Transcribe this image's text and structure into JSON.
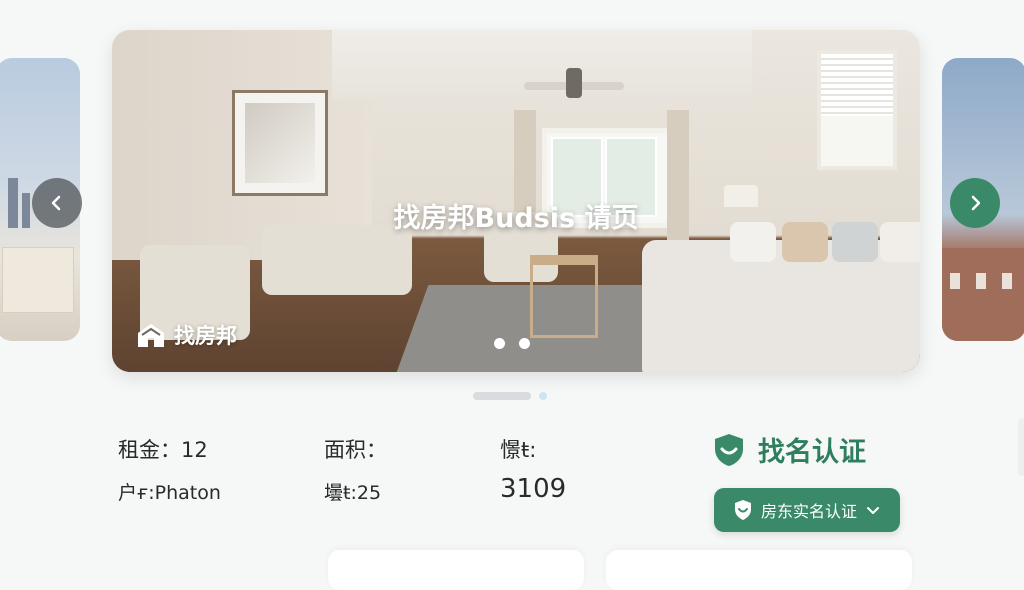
{
  "hero": {
    "title": "找房邦Budsis 请页",
    "brand_name": "找房邦",
    "indicator_dots": 2
  },
  "info": {
    "rent_label": "租金：",
    "rent_value": "12",
    "area_label": "面积：",
    "area_value": "",
    "col3_label": "憬ŧ:",
    "col3_value": "3109",
    "layout_label": "户ғ:",
    "layout_value": "Phaton",
    "floor_label": "壜ŧ:",
    "floor_value": "25"
  },
  "verify": {
    "title": "找名认证",
    "button_label": "房东实名认证"
  },
  "icons": {
    "prev": "chevron-left-icon",
    "next": "chevron-right-icon",
    "shield": "shield-smile-icon",
    "dropdown": "chevron-down-icon",
    "brand": "house-logo-icon"
  },
  "colors": {
    "accent": "#3a8a6a",
    "accent_text": "#2f7f5f"
  }
}
